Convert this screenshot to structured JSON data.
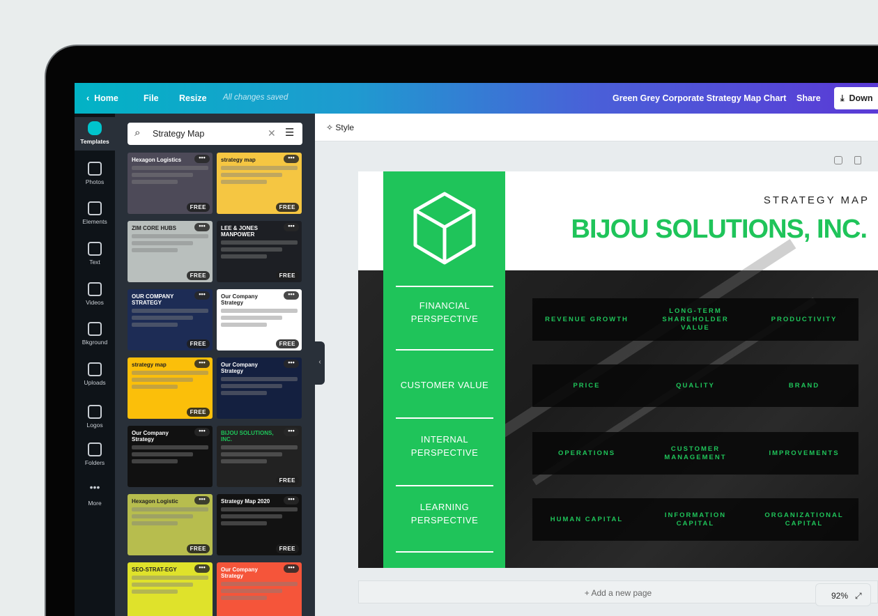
{
  "topbar": {
    "home": "Home",
    "file": "File",
    "resize": "Resize",
    "status": "All changes saved",
    "doc_title": "Green Grey Corporate Strategy Map Chart",
    "share": "Share",
    "download": "Down"
  },
  "rail": [
    {
      "label": "Templates",
      "icon": "templates-icon"
    },
    {
      "label": "Photos",
      "icon": "photos-icon"
    },
    {
      "label": "Elements",
      "icon": "elements-icon"
    },
    {
      "label": "Text",
      "icon": "text-icon"
    },
    {
      "label": "Videos",
      "icon": "videos-icon"
    },
    {
      "label": "Bkground",
      "icon": "background-icon"
    },
    {
      "label": "Uploads",
      "icon": "uploads-icon"
    },
    {
      "label": "Logos",
      "icon": "logos-icon"
    },
    {
      "label": "Folders",
      "icon": "folders-icon"
    },
    {
      "label": "More",
      "icon": "more-icon"
    }
  ],
  "search": {
    "value": "Strategy Map"
  },
  "templates": [
    {
      "title": "Hexagon Logistics",
      "badge": "FREE",
      "bg": "#4d4a58"
    },
    {
      "title": "strategy map",
      "badge": "FREE",
      "bg": "#f5c642"
    },
    {
      "title": "ZIM CORE HUBS",
      "badge": "FREE",
      "bg": "#b9bfbd"
    },
    {
      "title": "LEE & JONES MANPOWER",
      "badge": "FREE",
      "bg": "#1d1f24"
    },
    {
      "title": "OUR COMPANY STRATEGY",
      "badge": "FREE",
      "bg": "#1d2c55"
    },
    {
      "title": "Our Company Strategy",
      "badge": "FREE",
      "bg": "#ffffff"
    },
    {
      "title": "strategy map",
      "badge": "FREE",
      "bg": "#fbbf0a"
    },
    {
      "title": "Our Company Strategy",
      "badge": "",
      "bg": "#142040"
    },
    {
      "title": "Our Company Strategy",
      "badge": "",
      "bg": "#111111"
    },
    {
      "title": "BIJOU SOLUTIONS, INC.",
      "badge": "FREE",
      "bg": "#222222"
    },
    {
      "title": "Hexagon Logistic",
      "badge": "FREE",
      "bg": "#b7bd4e"
    },
    {
      "title": "Strategy Map 2020",
      "badge": "FREE",
      "bg": "#121212"
    },
    {
      "title": "SEO-STRAT-EGY",
      "badge": "",
      "bg": "#dfe22b"
    },
    {
      "title": "Our Company Strategy",
      "badge": "",
      "bg": "#f5553a"
    }
  ],
  "stylebar": {
    "style": "Style"
  },
  "design": {
    "subtitle": "STRATEGY MAP",
    "title": "BIJOU SOLUTIONS, INC.",
    "accent": "#1fc45a",
    "rows": [
      {
        "perspective": "FINANCIAL PERSPECTIVE",
        "items": [
          "REVENUE GROWTH",
          "LONG-TERM SHAREHOLDER VALUE",
          "PRODUCTIVITY"
        ]
      },
      {
        "perspective": "CUSTOMER VALUE",
        "items": [
          "PRICE",
          "QUALITY",
          "BRAND"
        ]
      },
      {
        "perspective": "INTERNAL PERSPECTIVE",
        "items": [
          "OPERATIONS",
          "CUSTOMER MANAGEMENT",
          "IMPROVEMENTS"
        ]
      },
      {
        "perspective": "LEARNING PERSPECTIVE",
        "items": [
          "HUMAN CAPITAL",
          "INFORMATION CAPITAL",
          "ORGANIZATIONAL CAPITAL"
        ]
      }
    ]
  },
  "footer": {
    "add_page": "+ Add a new page",
    "zoom": "92%"
  }
}
